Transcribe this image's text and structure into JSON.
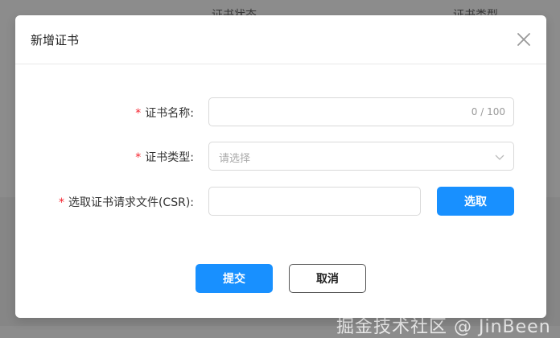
{
  "background": {
    "columns": [
      "证书状态",
      "证书类型"
    ],
    "watermark": "掘金技术社区 @ JinBeen"
  },
  "modal": {
    "title": "新增证书",
    "close_icon": "close-icon",
    "fields": {
      "name": {
        "required_mark": "*",
        "label": "证书名称:",
        "counter": "0 / 100",
        "value": ""
      },
      "type": {
        "required_mark": "*",
        "label": "证书类型:",
        "placeholder": "请选择",
        "value": ""
      },
      "csr": {
        "required_mark": "*",
        "label": "选取证书请求文件(CSR):",
        "value": "",
        "pick_label": "选取"
      }
    },
    "footer": {
      "submit_label": "提交",
      "cancel_label": "取消"
    },
    "colors": {
      "primary": "#1890ff",
      "required": "#f5222d"
    }
  }
}
